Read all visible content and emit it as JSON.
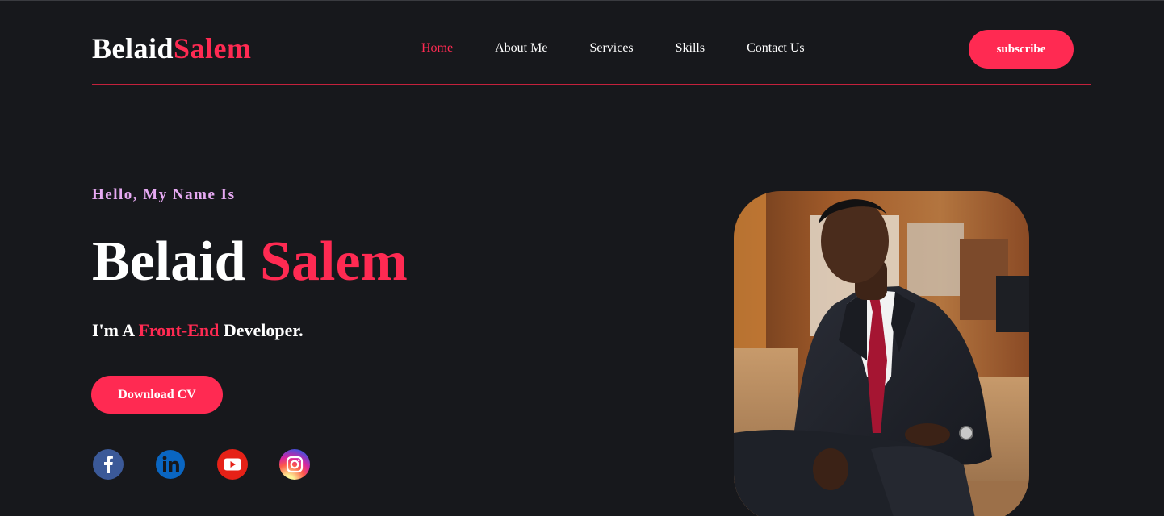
{
  "header": {
    "logo_first": "Belaid",
    "logo_second": "Salem",
    "nav": [
      {
        "label": "Home",
        "active": true
      },
      {
        "label": "About Me",
        "active": false
      },
      {
        "label": "Services",
        "active": false
      },
      {
        "label": "Skills",
        "active": false
      },
      {
        "label": "Contact Us",
        "active": false
      }
    ],
    "subscribe_label": "subscribe"
  },
  "hero": {
    "greeting": "Hello, My Name Is",
    "first_name": "Belaid",
    "last_name": "Salem",
    "tagline_prefix": "I'm A",
    "tagline_accent": "Front-End",
    "tagline_suffix": "Developer.",
    "download_label": "Download CV"
  },
  "socials": [
    {
      "icon": "facebook-icon",
      "color": "#3b5998"
    },
    {
      "icon": "linkedin-icon",
      "color": "#0a66c2"
    },
    {
      "icon": "youtube-icon",
      "color": "#e62117"
    },
    {
      "icon": "instagram-icon",
      "color": "#d6249f"
    }
  ],
  "theme": {
    "background": "#17181c",
    "accent": "#ff2a52",
    "greeting_color": "#e6a9f2"
  }
}
